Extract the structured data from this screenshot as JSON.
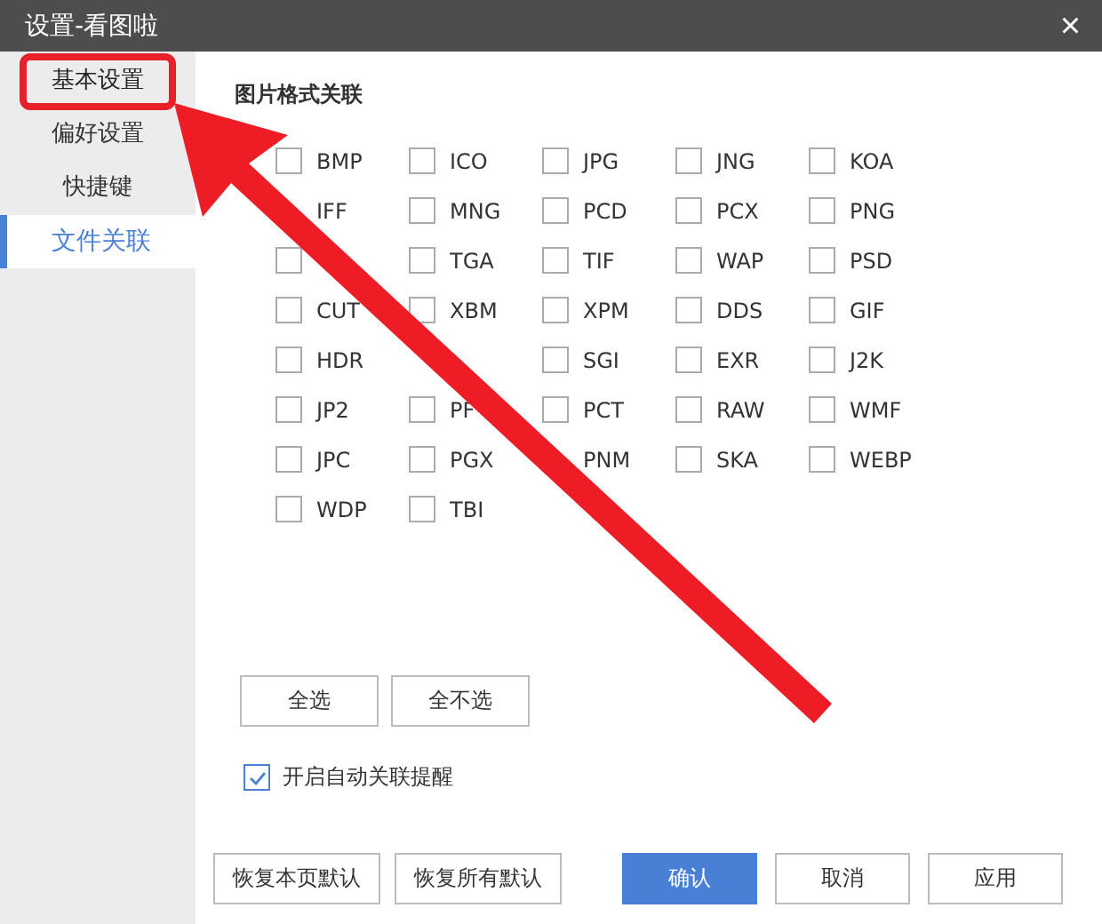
{
  "window": {
    "title": "设置-看图啦",
    "close": "×"
  },
  "sidebar": {
    "items": [
      {
        "label": "基本设置",
        "selected": false,
        "highlighted": true
      },
      {
        "label": "偏好设置",
        "selected": false,
        "highlighted": false
      },
      {
        "label": "快捷键",
        "selected": false,
        "highlighted": false
      },
      {
        "label": "文件关联",
        "selected": true,
        "highlighted": false
      }
    ]
  },
  "section": {
    "title": "图片格式关联"
  },
  "formats": [
    {
      "label": "BMP",
      "checked": false
    },
    {
      "label": "ICO",
      "checked": false
    },
    {
      "label": "JPG",
      "checked": false
    },
    {
      "label": "JNG",
      "checked": false
    },
    {
      "label": "KOA",
      "checked": false
    },
    {
      "label": "IFF"
    },
    {
      "label": "MNG",
      "checked": false
    },
    {
      "label": "PCD",
      "checked": false
    },
    {
      "label": "PCX",
      "checked": false
    },
    {
      "label": "PNG",
      "checked": false
    },
    {
      "checked": false
    },
    {
      "label": "TGA",
      "checked": false
    },
    {
      "label": "TIF",
      "checked": false
    },
    {
      "label": "WAP",
      "checked": false
    },
    {
      "label": "PSD",
      "checked": false
    },
    {
      "label": "CUT",
      "checked": false
    },
    {
      "label": "XBM",
      "checked": false
    },
    {
      "label": "XPM",
      "checked": false
    },
    {
      "label": "DDS",
      "checked": false
    },
    {
      "label": "GIF",
      "checked": false
    },
    {
      "label": "HDR",
      "checked": false
    },
    {
      "kind": "covered"
    },
    {
      "label": "SGI",
      "checked": false
    },
    {
      "label": "EXR",
      "checked": false
    },
    {
      "label": "J2K",
      "checked": false
    },
    {
      "label": "JP2",
      "checked": false
    },
    {
      "label": "PF",
      "checked": false
    },
    {
      "label": "PCT",
      "checked": false
    },
    {
      "label": "RAW",
      "checked": false
    },
    {
      "label": "WMF",
      "checked": false
    },
    {
      "label": "JPC",
      "checked": false
    },
    {
      "label": "PGX",
      "checked": false
    },
    {
      "label": "PNM"
    },
    {
      "label": "SKA",
      "checked": false
    },
    {
      "label": "WEBP",
      "checked": false
    },
    {
      "label": "WDP",
      "checked": false
    },
    {
      "label": "TBI",
      "checked": false
    }
  ],
  "select_buttons": [
    "全选",
    "全不选"
  ],
  "auto_prompt": {
    "label": "开启自动关联提醒",
    "checked": true
  },
  "footer_buttons": [
    {
      "label": "恢复本页默认",
      "kind": "plain"
    },
    {
      "label": "恢复所有默认",
      "kind": "plain"
    },
    {
      "label": "确认",
      "kind": "primary"
    },
    {
      "label": "取消",
      "kind": "plain"
    },
    {
      "label": "应用",
      "kind": "plain"
    }
  ]
}
